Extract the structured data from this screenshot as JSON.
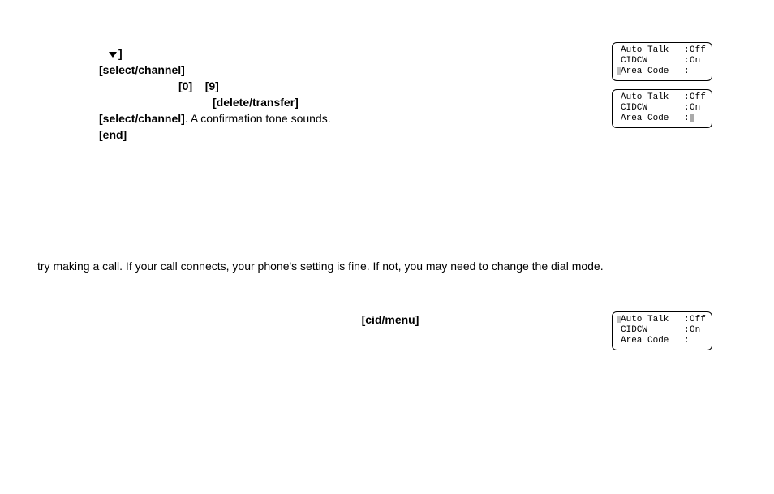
{
  "block1": {
    "arrow_bracket": "]",
    "select_channel": "[select/channel]",
    "zero": "[0]",
    "nine": "[9]",
    "delete_transfer": "[delete/transfer]",
    "confirmation_tail": ". A confirmation tone sounds.",
    "end": "[end]"
  },
  "block2": {
    "text": "try making a call. If your call connects, your phone's setting is fine. If not, you may need to change the dial mode."
  },
  "block3": {
    "cid_menu": "[cid/menu]"
  },
  "lcd_common": {
    "auto_talk": "Auto Talk",
    "cidcw": "CIDCW",
    "area_code": "Area Code",
    "off": "Off",
    "on": "On"
  },
  "lcd1": {
    "cursor_row": 2
  },
  "lcd2": {
    "cursor_row": null,
    "area_code_cursor_block": true
  },
  "lcd3": {
    "cursor_row": 0
  }
}
